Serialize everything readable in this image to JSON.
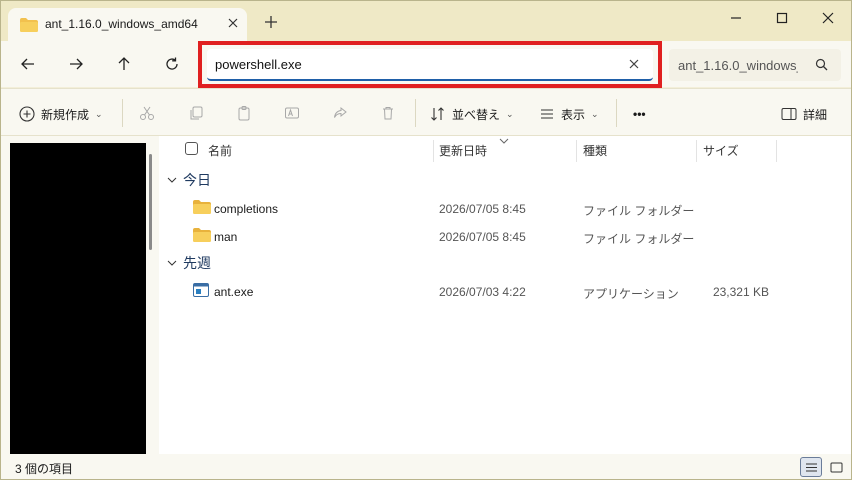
{
  "window": {
    "tab_title": "ant_1.16.0_windows_amd64",
    "icons": [
      "folder-icon",
      "close-icon",
      "plus-icon",
      "minimize-icon",
      "maximize-icon",
      "close-window-icon"
    ]
  },
  "address": {
    "value": "powershell.exe",
    "highlight_color": "#e02020",
    "search_placeholder": "ant_1.16.0_windows_amd64"
  },
  "toolbar": {
    "new_label": "新規作成",
    "sort_label": "並べ替え",
    "view_label": "表示",
    "more_label": "•••",
    "details_label": "詳細"
  },
  "columns": {
    "name": "名前",
    "date": "更新日時",
    "type": "種類",
    "size": "サイズ"
  },
  "groups": [
    {
      "label": "今日",
      "items": [
        {
          "name": "completions",
          "date": "2026/07/05 8:45",
          "type": "ファイル フォルダー",
          "size": "",
          "icon": "folder-icon"
        },
        {
          "name": "man",
          "date": "2026/07/05 8:45",
          "type": "ファイル フォルダー",
          "size": "",
          "icon": "folder-icon"
        }
      ]
    },
    {
      "label": "先週",
      "items": [
        {
          "name": "ant.exe",
          "date": "2026/07/03 4:22",
          "type": "アプリケーション",
          "size": "23,321 KB",
          "icon": "application-icon"
        }
      ]
    }
  ],
  "status": {
    "item_count": "3 個の項目"
  },
  "colors": {
    "accent": "#1f5fa8",
    "folder": "#f2c14e",
    "titlebar": "#efe9c6"
  }
}
